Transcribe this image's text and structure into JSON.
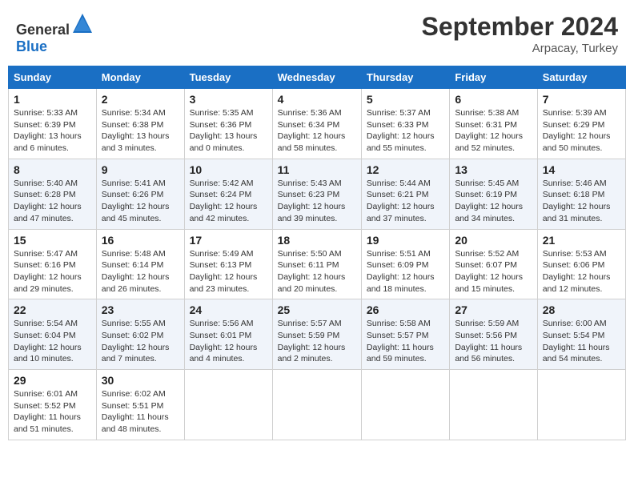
{
  "header": {
    "logo_general": "General",
    "logo_blue": "Blue",
    "month": "September 2024",
    "location": "Arpacay, Turkey"
  },
  "days_of_week": [
    "Sunday",
    "Monday",
    "Tuesday",
    "Wednesday",
    "Thursday",
    "Friday",
    "Saturday"
  ],
  "weeks": [
    [
      {
        "day": "1",
        "sunrise": "Sunrise: 5:33 AM",
        "sunset": "Sunset: 6:39 PM",
        "daylight": "Daylight: 13 hours and 6 minutes."
      },
      {
        "day": "2",
        "sunrise": "Sunrise: 5:34 AM",
        "sunset": "Sunset: 6:38 PM",
        "daylight": "Daylight: 13 hours and 3 minutes."
      },
      {
        "day": "3",
        "sunrise": "Sunrise: 5:35 AM",
        "sunset": "Sunset: 6:36 PM",
        "daylight": "Daylight: 13 hours and 0 minutes."
      },
      {
        "day": "4",
        "sunrise": "Sunrise: 5:36 AM",
        "sunset": "Sunset: 6:34 PM",
        "daylight": "Daylight: 12 hours and 58 minutes."
      },
      {
        "day": "5",
        "sunrise": "Sunrise: 5:37 AM",
        "sunset": "Sunset: 6:33 PM",
        "daylight": "Daylight: 12 hours and 55 minutes."
      },
      {
        "day": "6",
        "sunrise": "Sunrise: 5:38 AM",
        "sunset": "Sunset: 6:31 PM",
        "daylight": "Daylight: 12 hours and 52 minutes."
      },
      {
        "day": "7",
        "sunrise": "Sunrise: 5:39 AM",
        "sunset": "Sunset: 6:29 PM",
        "daylight": "Daylight: 12 hours and 50 minutes."
      }
    ],
    [
      {
        "day": "8",
        "sunrise": "Sunrise: 5:40 AM",
        "sunset": "Sunset: 6:28 PM",
        "daylight": "Daylight: 12 hours and 47 minutes."
      },
      {
        "day": "9",
        "sunrise": "Sunrise: 5:41 AM",
        "sunset": "Sunset: 6:26 PM",
        "daylight": "Daylight: 12 hours and 45 minutes."
      },
      {
        "day": "10",
        "sunrise": "Sunrise: 5:42 AM",
        "sunset": "Sunset: 6:24 PM",
        "daylight": "Daylight: 12 hours and 42 minutes."
      },
      {
        "day": "11",
        "sunrise": "Sunrise: 5:43 AM",
        "sunset": "Sunset: 6:23 PM",
        "daylight": "Daylight: 12 hours and 39 minutes."
      },
      {
        "day": "12",
        "sunrise": "Sunrise: 5:44 AM",
        "sunset": "Sunset: 6:21 PM",
        "daylight": "Daylight: 12 hours and 37 minutes."
      },
      {
        "day": "13",
        "sunrise": "Sunrise: 5:45 AM",
        "sunset": "Sunset: 6:19 PM",
        "daylight": "Daylight: 12 hours and 34 minutes."
      },
      {
        "day": "14",
        "sunrise": "Sunrise: 5:46 AM",
        "sunset": "Sunset: 6:18 PM",
        "daylight": "Daylight: 12 hours and 31 minutes."
      }
    ],
    [
      {
        "day": "15",
        "sunrise": "Sunrise: 5:47 AM",
        "sunset": "Sunset: 6:16 PM",
        "daylight": "Daylight: 12 hours and 29 minutes."
      },
      {
        "day": "16",
        "sunrise": "Sunrise: 5:48 AM",
        "sunset": "Sunset: 6:14 PM",
        "daylight": "Daylight: 12 hours and 26 minutes."
      },
      {
        "day": "17",
        "sunrise": "Sunrise: 5:49 AM",
        "sunset": "Sunset: 6:13 PM",
        "daylight": "Daylight: 12 hours and 23 minutes."
      },
      {
        "day": "18",
        "sunrise": "Sunrise: 5:50 AM",
        "sunset": "Sunset: 6:11 PM",
        "daylight": "Daylight: 12 hours and 20 minutes."
      },
      {
        "day": "19",
        "sunrise": "Sunrise: 5:51 AM",
        "sunset": "Sunset: 6:09 PM",
        "daylight": "Daylight: 12 hours and 18 minutes."
      },
      {
        "day": "20",
        "sunrise": "Sunrise: 5:52 AM",
        "sunset": "Sunset: 6:07 PM",
        "daylight": "Daylight: 12 hours and 15 minutes."
      },
      {
        "day": "21",
        "sunrise": "Sunrise: 5:53 AM",
        "sunset": "Sunset: 6:06 PM",
        "daylight": "Daylight: 12 hours and 12 minutes."
      }
    ],
    [
      {
        "day": "22",
        "sunrise": "Sunrise: 5:54 AM",
        "sunset": "Sunset: 6:04 PM",
        "daylight": "Daylight: 12 hours and 10 minutes."
      },
      {
        "day": "23",
        "sunrise": "Sunrise: 5:55 AM",
        "sunset": "Sunset: 6:02 PM",
        "daylight": "Daylight: 12 hours and 7 minutes."
      },
      {
        "day": "24",
        "sunrise": "Sunrise: 5:56 AM",
        "sunset": "Sunset: 6:01 PM",
        "daylight": "Daylight: 12 hours and 4 minutes."
      },
      {
        "day": "25",
        "sunrise": "Sunrise: 5:57 AM",
        "sunset": "Sunset: 5:59 PM",
        "daylight": "Daylight: 12 hours and 2 minutes."
      },
      {
        "day": "26",
        "sunrise": "Sunrise: 5:58 AM",
        "sunset": "Sunset: 5:57 PM",
        "daylight": "Daylight: 11 hours and 59 minutes."
      },
      {
        "day": "27",
        "sunrise": "Sunrise: 5:59 AM",
        "sunset": "Sunset: 5:56 PM",
        "daylight": "Daylight: 11 hours and 56 minutes."
      },
      {
        "day": "28",
        "sunrise": "Sunrise: 6:00 AM",
        "sunset": "Sunset: 5:54 PM",
        "daylight": "Daylight: 11 hours and 54 minutes."
      }
    ],
    [
      {
        "day": "29",
        "sunrise": "Sunrise: 6:01 AM",
        "sunset": "Sunset: 5:52 PM",
        "daylight": "Daylight: 11 hours and 51 minutes."
      },
      {
        "day": "30",
        "sunrise": "Sunrise: 6:02 AM",
        "sunset": "Sunset: 5:51 PM",
        "daylight": "Daylight: 11 hours and 48 minutes."
      },
      null,
      null,
      null,
      null,
      null
    ]
  ]
}
